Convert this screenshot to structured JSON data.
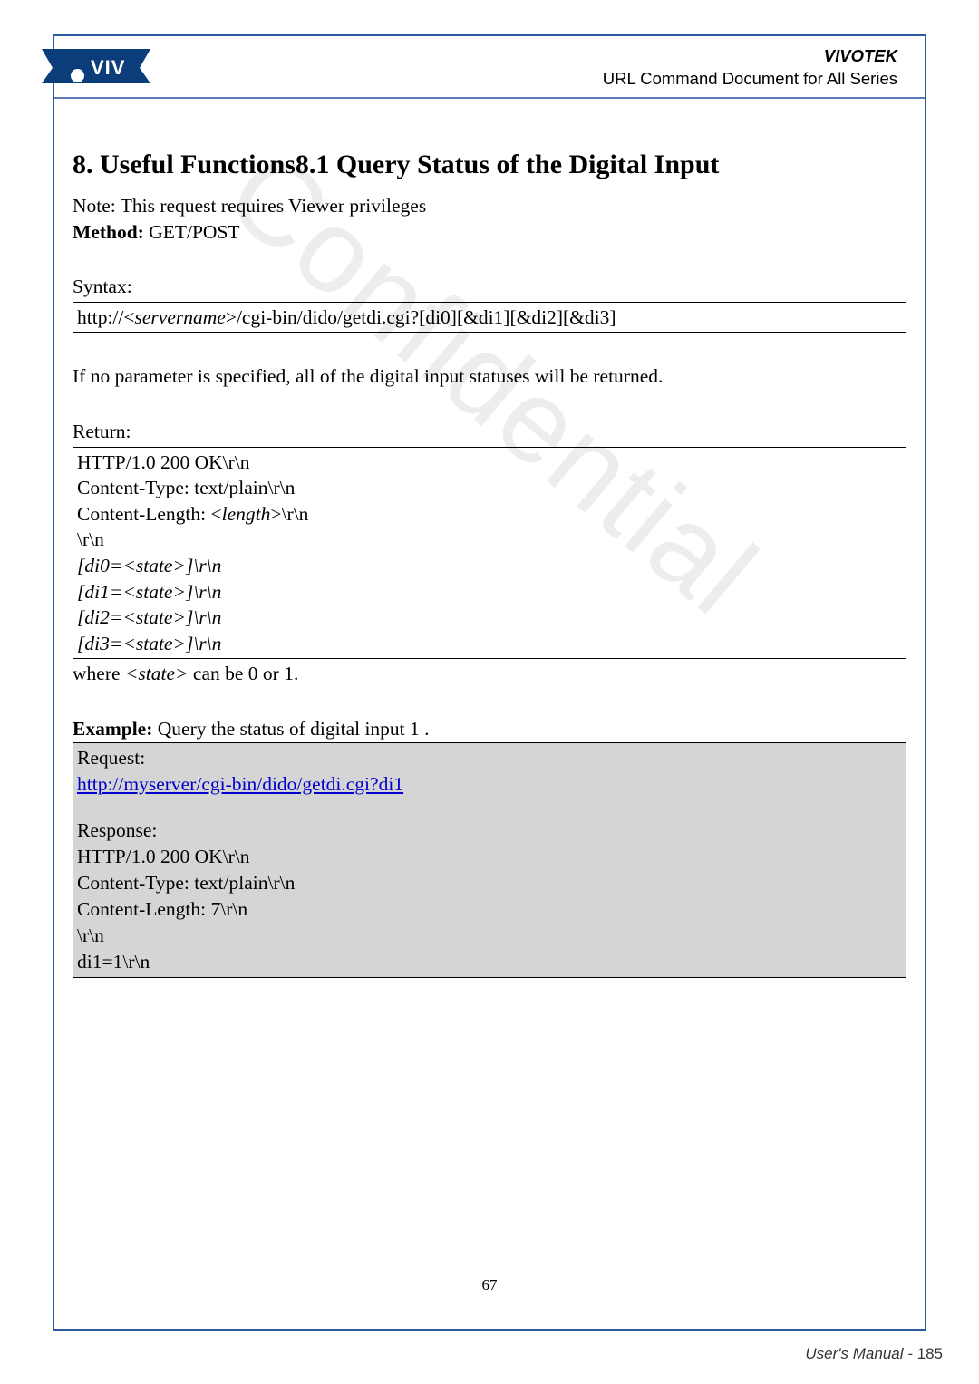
{
  "header": {
    "brand": "VIVOTEK",
    "doc_title": "URL Command Document for All Series",
    "logo_text": "VIV"
  },
  "watermark": "Confidential",
  "section": {
    "heading": "8. Useful Functions8.1 Query Status of the Digital Input",
    "note": "Note: This request requires Viewer privileges",
    "method_label": "Method:",
    "method_value": " GET/POST",
    "syntax_label": "Syntax:",
    "syntax_box": {
      "prefix": "http://<",
      "server_var": "servername",
      "suffix": ">/cgi-bin/dido/getdi.cgi?[di0][&di1][&di2][&di3]"
    },
    "param_note": "If no parameter is specified, all of the digital input statuses will be returned.",
    "return_label": "Return:",
    "return_lines": [
      {
        "text": "HTTP/1.0 200 OK\\r\\n",
        "italic": false
      },
      {
        "text": "Content-Type: text/plain\\r\\n",
        "italic": false
      },
      {
        "prefix": "Content-Length: <",
        "var": "length",
        "suffix": ">\\r\\n"
      },
      {
        "text": "\\r\\n",
        "italic": false
      },
      {
        "text": "[di0=<state>]\\r\\n",
        "italic": true
      },
      {
        "text": "[di1=<state>]\\r\\n",
        "italic": true
      },
      {
        "text": "[di2=<state>]\\r\\n",
        "italic": true
      },
      {
        "text": "[di3=<state>]\\r\\n",
        "italic": true
      }
    ],
    "where_prefix": "where ",
    "where_var": "<state>",
    "where_suffix": " can be 0 or 1.",
    "example_label": "Example:",
    "example_text": " Query the status of digital input 1 .",
    "shade": {
      "request_label": "Request:",
      "request_url": "http://myserver/cgi-bin/dido/getdi.cgi?di1",
      "response_label": "Response:",
      "response_lines": [
        "HTTP/1.0 200 OK\\r\\n",
        "Content-Type: text/plain\\r\\n",
        "Content-Length: 7\\r\\n",
        "\\r\\n",
        "di1=1\\r\\n"
      ]
    }
  },
  "footer": {
    "mid_page": "67",
    "right_label": "User's Manual - ",
    "right_page": "185"
  }
}
